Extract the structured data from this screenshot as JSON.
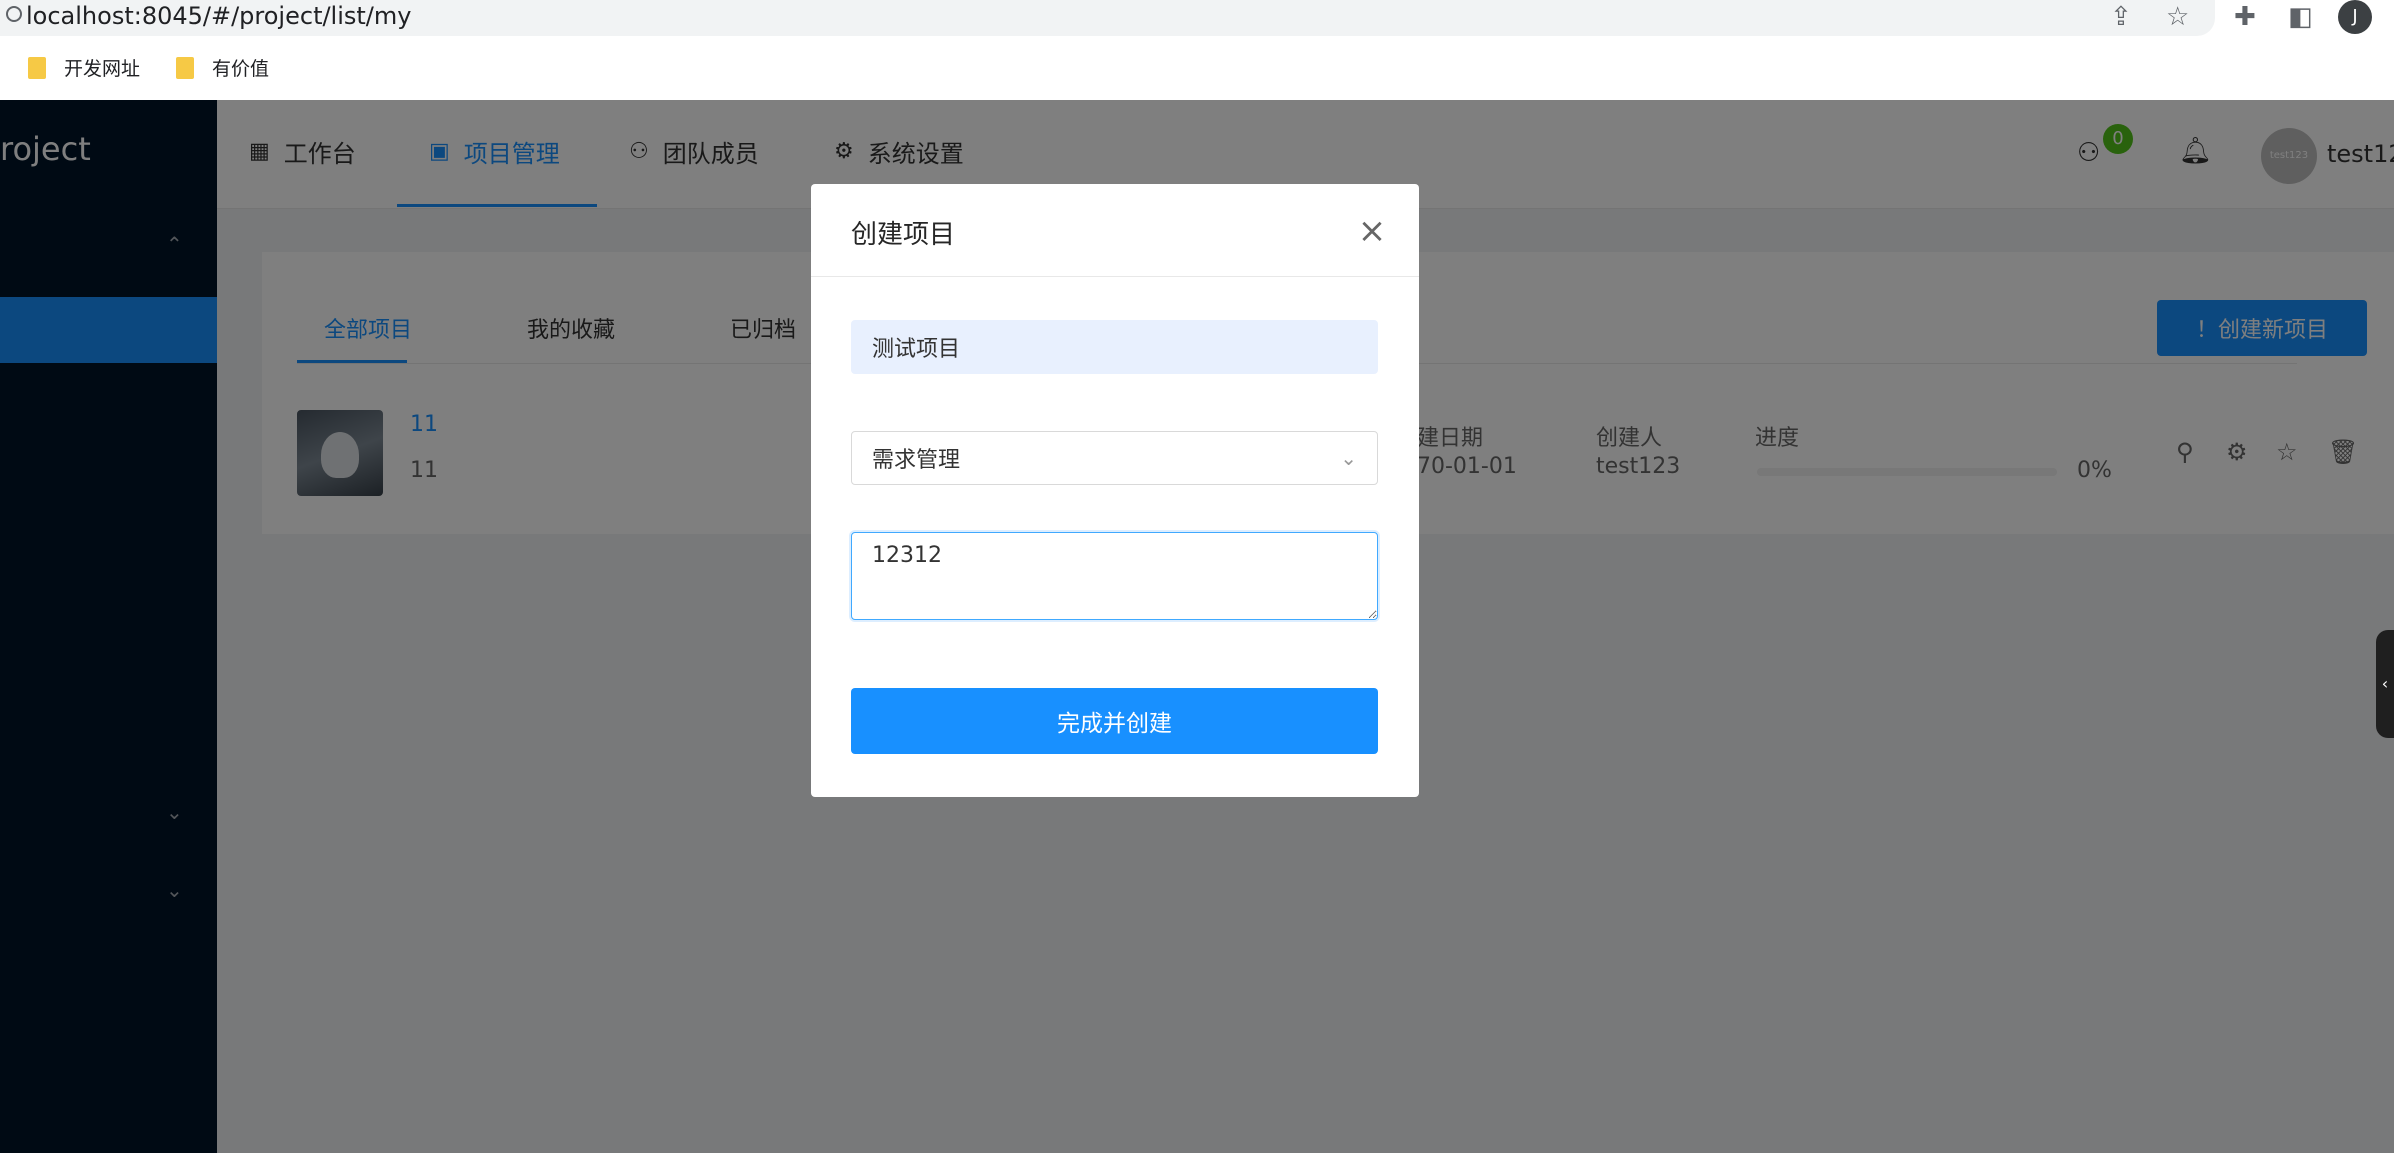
{
  "browser": {
    "url": "localhost:8045/#/project/list/my",
    "profile_initial": "J",
    "bookmarks": [
      {
        "label": "开发网址"
      },
      {
        "label": "有价值"
      }
    ]
  },
  "sidebar": {
    "logo_text": "roject"
  },
  "header": {
    "nav": [
      {
        "label": "工作台",
        "icon": "grid-icon"
      },
      {
        "label": "项目管理",
        "icon": "project-icon",
        "active": true
      },
      {
        "label": "团队成员",
        "icon": "team-icon"
      },
      {
        "label": "系统设置",
        "icon": "settings-icon"
      }
    ],
    "notification_count": "0",
    "avatar_text": "test123",
    "username": "test12"
  },
  "content": {
    "tabs": [
      {
        "label": "全部项目",
        "active": true
      },
      {
        "label": "我的收藏"
      },
      {
        "label": "已归档"
      }
    ],
    "create_button": "！创建新项目",
    "project": {
      "name": "11",
      "description": "11",
      "created_date_label": "建日期",
      "created_date": "70-01-01",
      "creator_label": "创建人",
      "creator": "test123",
      "progress_label": "进度",
      "progress": "0%"
    }
  },
  "modal": {
    "title": "创建项目",
    "name_value": "测试项目",
    "template_value": "需求管理",
    "description_value": "12312",
    "submit_label": "完成并创建"
  },
  "colors": {
    "primary": "#1890ff",
    "sidebar_bg": "#001529",
    "badge_green": "#52c41a"
  }
}
